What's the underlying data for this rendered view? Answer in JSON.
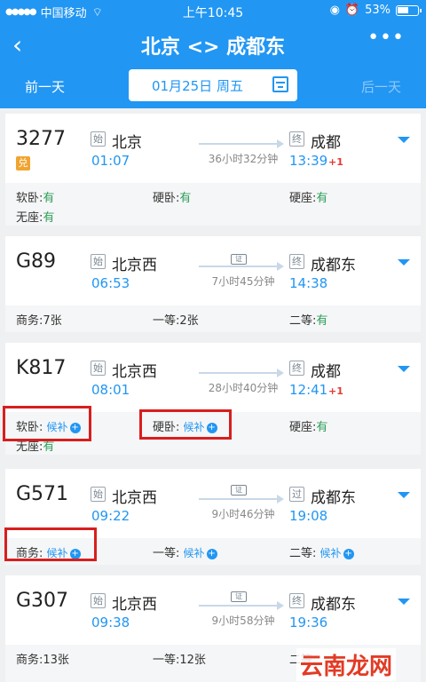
{
  "status": {
    "carrier": "中国移动",
    "time": "上午10:45",
    "battery": "53%"
  },
  "nav": {
    "title": "北京 <> 成都东"
  },
  "date": {
    "prev": "前一天",
    "current": "01月25日 周五",
    "next": "后一天"
  },
  "trains": [
    {
      "no": "3277",
      "badge": "兑",
      "from_tag": "始",
      "from": "北京",
      "dep": "01:07",
      "duration": "36小时32分钟",
      "to_tag": "终",
      "to": "成都",
      "arr": "13:39",
      "plus": "+1",
      "seats": [
        {
          "label": "软卧:",
          "val": "有"
        },
        {
          "label": "硬卧:",
          "val": "有"
        },
        {
          "label": "硬座:",
          "val": "有"
        },
        {
          "label": "无座:",
          "val": "有"
        }
      ]
    },
    {
      "no": "G89",
      "from_tag": "始",
      "from": "北京西",
      "dep": "06:53",
      "duration": "7小时45分钟",
      "to_tag": "终",
      "to": "成都东",
      "arr": "14:38",
      "seats": [
        {
          "label": "商务:",
          "val": "7张"
        },
        {
          "label": "一等:",
          "val": "2张"
        },
        {
          "label": "二等:",
          "val": "有"
        }
      ]
    },
    {
      "no": "K817",
      "from_tag": "始",
      "from": "北京西",
      "dep": "08:01",
      "duration": "28小时40分钟",
      "to_tag": "终",
      "to": "成都",
      "arr": "12:41",
      "plus": "+1",
      "seats": [
        {
          "label": "软卧:",
          "val": "候补"
        },
        {
          "label": "硬卧:",
          "val": "候补"
        },
        {
          "label": "硬座:",
          "val": "有"
        },
        {
          "label": "无座:",
          "val": "有"
        }
      ]
    },
    {
      "no": "G571",
      "from_tag": "始",
      "from": "北京西",
      "dep": "09:22",
      "duration": "9小时46分钟",
      "to_tag": "过",
      "to": "成都东",
      "arr": "19:08",
      "seats": [
        {
          "label": "商务:",
          "val": "候补"
        },
        {
          "label": "一等:",
          "val": "候补"
        },
        {
          "label": "二等:",
          "val": "候补"
        }
      ]
    },
    {
      "no": "G307",
      "from_tag": "始",
      "from": "北京西",
      "dep": "09:38",
      "duration": "9小时58分钟",
      "to_tag": "终",
      "to": "成都东",
      "arr": "19:36",
      "seats": [
        {
          "label": "商务:",
          "val": "13张"
        },
        {
          "label": "一等:",
          "val": "12张"
        },
        {
          "label": "二等:",
          "val": ""
        }
      ]
    }
  ],
  "icons": {
    "plus": "+",
    "id": "证"
  },
  "watermark": "云南龙网",
  "colors": {
    "primary": "#2196f3",
    "available": "#2e9e5a",
    "highlight": "#d81e1e"
  }
}
